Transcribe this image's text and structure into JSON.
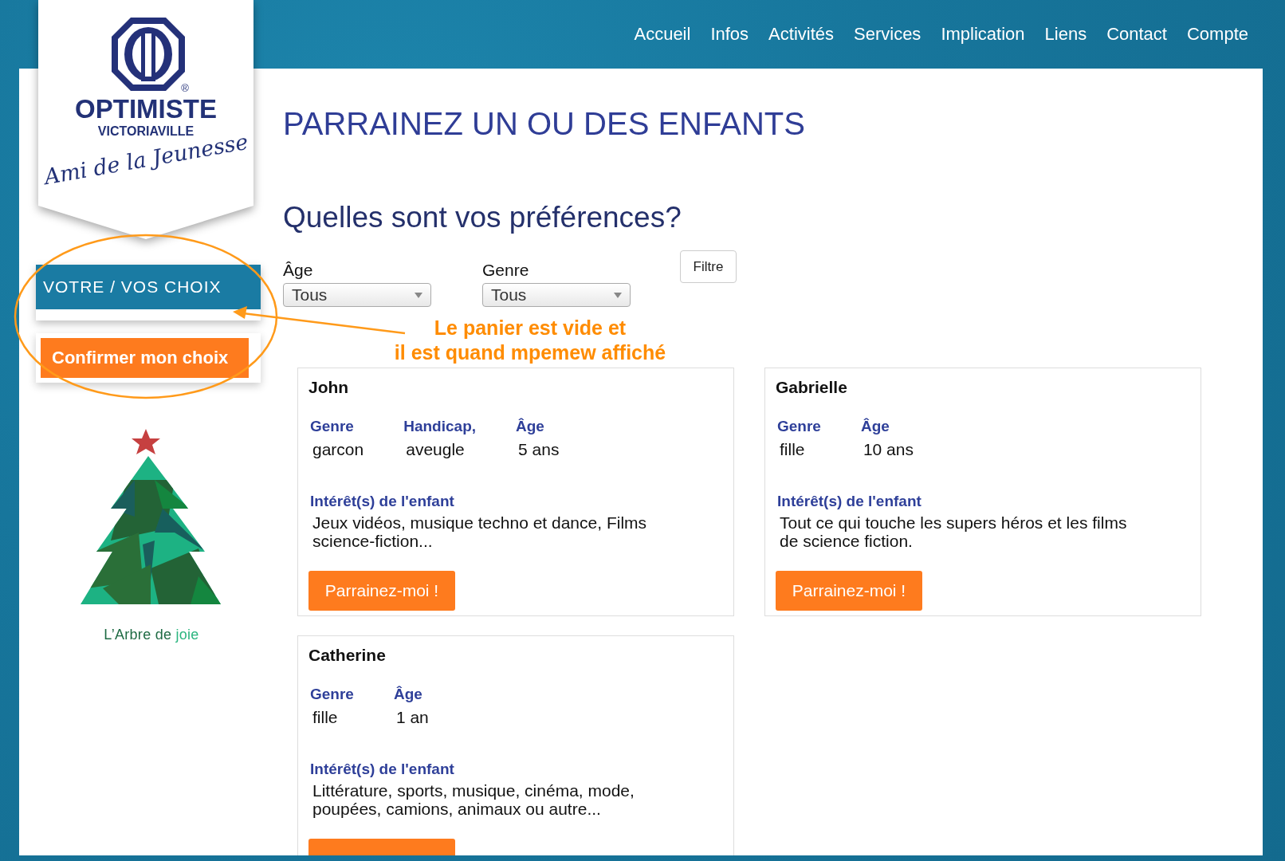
{
  "nav": {
    "items": [
      "Accueil",
      "Infos",
      "Activités",
      "Services",
      "Implication",
      "Liens",
      "Contact",
      "Compte"
    ]
  },
  "logo": {
    "registered": "®",
    "name": "OPTIMISTE",
    "city": "VICTORIAVILLE",
    "slogan": "Ami de la Jeunesse"
  },
  "sidebar": {
    "cart_title": "VOTRE / VOS CHOIX",
    "confirm_button": "Confirmer mon choix",
    "caption": [
      {
        "text": "L’Arbre de",
        "color": "#1f6b44"
      },
      {
        "text": "joie",
        "color": "#2bb57f"
      }
    ]
  },
  "page_title": "PARRAINEZ UN OU DES ENFANTS",
  "heading": "Quelles sont vos préférences?",
  "filters": [
    {
      "label": "Âge",
      "value": "Tous"
    },
    {
      "label": "Genre",
      "value": "Tous"
    }
  ],
  "filter_button": "Filtre",
  "annotation": {
    "lines": [
      "Le panier est vide et",
      "il est quand mpemew affiché"
    ]
  },
  "children": [
    {
      "name": "John",
      "fields": [
        {
          "label": "Genre",
          "value": "garcon"
        },
        {
          "label": "Handicap,",
          "value": "aveugle"
        },
        {
          "label": "Âge",
          "value": "5 ans"
        }
      ],
      "interests_label": "Intérêt(s) de l'enfant",
      "interests": "Jeux vidéos, musique techno et dance, Films science-fiction...",
      "button": {
        "label": "Parrainez-moi !"
      }
    },
    {
      "name": "Gabrielle",
      "fields": [
        {
          "label": "Genre",
          "value": "fille"
        },
        {
          "label": "Âge",
          "value": "10 ans"
        }
      ],
      "interests_label": "Intérêt(s) de l'enfant",
      "interests": "Tout ce qui touche les supers héros et les films de science fiction.",
      "button": {
        "label": "Parrainez-moi !"
      }
    },
    {
      "name": "Catherine",
      "fields": [
        {
          "label": "Genre",
          "value": "fille"
        },
        {
          "label": "Âge",
          "value": "1 an"
        }
      ],
      "interests_label": "Intérêt(s) de l'enfant",
      "interests": "Littérature, sports, musique, cinéma, mode, poupées, camions, animaux ou autre...",
      "button": {
        "clipped": true
      }
    }
  ]
}
